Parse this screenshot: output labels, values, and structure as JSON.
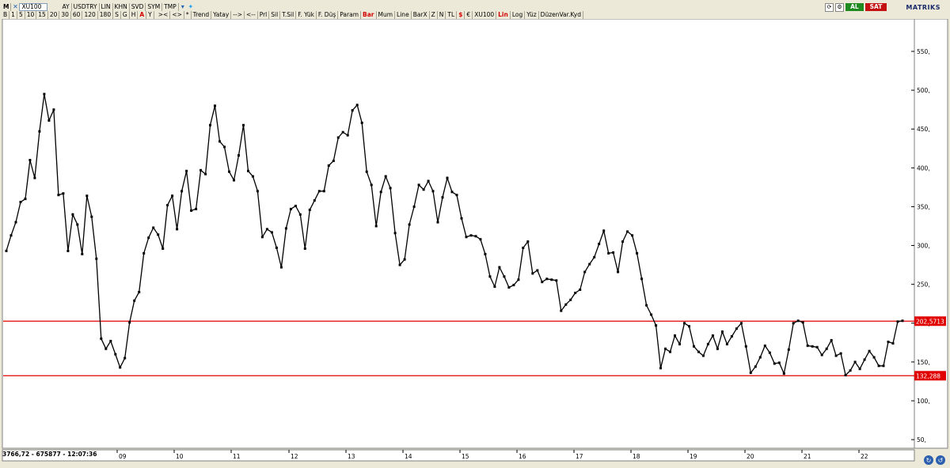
{
  "toolbar": {
    "m_label": "M",
    "symbol": "XU100",
    "row1": [
      {
        "name": "ay-button",
        "label": "AY"
      },
      {
        "name": "usdtry-button",
        "label": "USDTRY"
      },
      {
        "name": "lin-button",
        "label": "LIN"
      },
      {
        "name": "khn-button",
        "label": "KHN"
      },
      {
        "name": "svd-button",
        "label": "SVD"
      },
      {
        "name": "sym-button",
        "label": "SYM"
      },
      {
        "name": "tmp-button",
        "label": "TMP"
      }
    ],
    "periods": [
      "B",
      "1",
      "5",
      "10",
      "15",
      "20",
      "30",
      "60",
      "120",
      "180",
      "S",
      "G",
      "H",
      "A",
      "Y"
    ],
    "row2": [
      ">< ",
      "<>",
      "*",
      "Trend",
      "Yatay",
      "-->",
      "<--",
      "Prl",
      "Sil",
      "T.Sil",
      "F. Yük",
      "F. Düş",
      "Param",
      "Bar",
      "Mum",
      "Line",
      "BarX",
      "Z",
      "N",
      "TL",
      "$",
      "€",
      "XU100",
      "Lin",
      "Log",
      "Yüz",
      "DüzenVar.Kyd"
    ],
    "buy_label": "AL",
    "sell_label": "SAT",
    "brand": "MATRIKS"
  },
  "status": {
    "readout": "3766,72 - 675877 - 12:07:36"
  },
  "colors": {
    "line": "#000000",
    "level": "#e00000",
    "level_label_bg": "#e00000",
    "accent_blue": "#1c5fb5"
  },
  "chart_data": {
    "type": "line",
    "y_ticks": [
      "50,",
      "100,",
      "150,",
      "200,",
      "250,",
      "300,",
      "350,",
      "400,",
      "450,",
      "500,",
      "550,"
    ],
    "ylim": [
      40,
      590
    ],
    "x_ticks": [
      "09",
      "10",
      "11",
      "12",
      "13",
      "14",
      "15",
      "16",
      "17",
      "18",
      "19",
      "20",
      "21",
      "22"
    ],
    "levels": [
      {
        "value": 202.5713,
        "label": "202,5713"
      },
      {
        "value": 132.288,
        "label": "132,288"
      }
    ],
    "grid": false,
    "values": [
      293,
      313,
      330,
      356,
      360,
      410,
      387,
      447,
      495,
      461,
      475,
      365,
      367,
      293,
      340,
      327,
      289,
      364,
      337,
      283,
      180,
      167,
      177,
      160,
      143,
      155,
      201,
      229,
      240,
      290,
      310,
      323,
      314,
      296,
      352,
      364,
      321,
      370,
      396,
      345,
      347,
      397,
      392,
      455,
      480,
      434,
      427,
      395,
      384,
      416,
      455,
      396,
      389,
      370,
      311,
      321,
      317,
      297,
      272,
      322,
      347,
      351,
      340,
      296,
      346,
      358,
      370,
      370,
      403,
      409,
      439,
      446,
      442,
      474,
      481,
      458,
      395,
      378,
      325,
      369,
      389,
      374,
      316,
      275,
      282,
      327,
      350,
      378,
      372,
      383,
      370,
      330,
      362,
      387,
      369,
      365,
      335,
      311,
      313,
      312,
      308,
      289,
      260,
      247,
      272,
      260,
      246,
      249,
      256,
      297,
      305,
      264,
      268,
      253,
      257,
      256,
      255,
      216,
      224,
      230,
      239,
      243,
      266,
      276,
      285,
      302,
      319,
      290,
      291,
      266,
      305,
      318,
      313,
      290,
      257,
      223,
      211,
      197,
      142,
      167,
      163,
      184,
      173,
      200,
      196,
      170,
      163,
      158,
      173,
      184,
      167,
      189,
      173,
      183,
      193,
      200,
      170,
      136,
      144,
      156,
      171,
      162,
      148,
      149,
      135,
      166,
      200,
      203,
      201,
      171,
      170,
      169,
      159,
      167,
      178,
      158,
      161,
      133,
      139,
      150,
      141,
      153,
      164,
      156,
      145,
      145,
      176,
      174,
      202,
      203
    ]
  }
}
